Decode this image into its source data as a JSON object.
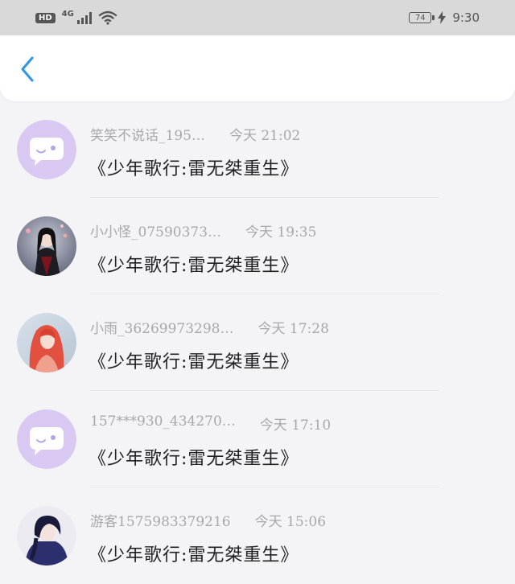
{
  "status_bar": {
    "hd": "HD",
    "network": "4G",
    "battery": "74",
    "time": "9:30"
  },
  "header": {
    "back_icon": "chevron-left-icon",
    "accent_color": "#2f95e6"
  },
  "messages": [
    {
      "avatar": "default-chat-icon",
      "name": "笑笑不说话_195…",
      "time": "今天 21:02",
      "text": "《少年歌行:雷无桀重生》"
    },
    {
      "avatar": "dark-robed-figure",
      "name": "小小怪_07590373…",
      "time": "今天 19:35",
      "text": "《少年歌行:雷无桀重生》"
    },
    {
      "avatar": "red-haired-girl",
      "name": "小雨_36269973298…",
      "time": "今天 17:28",
      "text": "《少年歌行:雷无桀重生》"
    },
    {
      "avatar": "default-chat-icon",
      "name": "157***930_434270…",
      "time": "今天 17:10",
      "text": "《少年歌行:雷无桀重生》"
    },
    {
      "avatar": "blue-haired-figure",
      "name": "游客1575983379216",
      "time": "今天 15:06",
      "text": "《少年歌行:雷无桀重生》"
    }
  ]
}
